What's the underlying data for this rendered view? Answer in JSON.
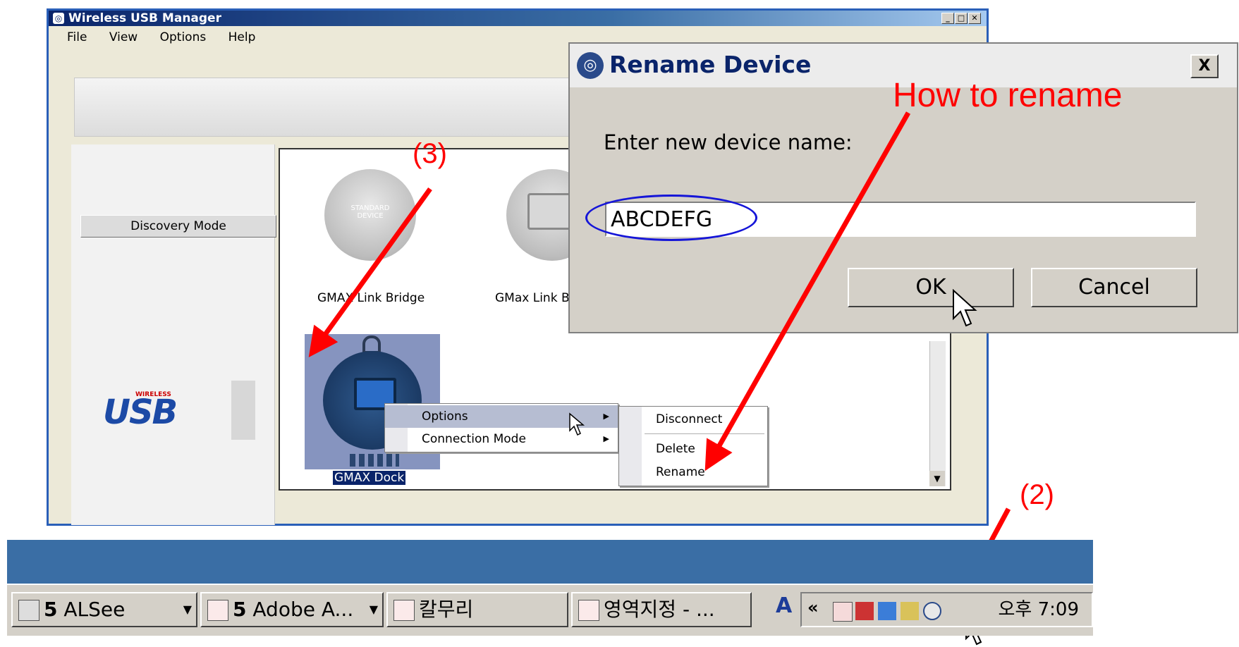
{
  "main_window": {
    "title": "Wireless USB Manager",
    "menu": [
      "File",
      "View",
      "Options",
      "Help"
    ],
    "discovery_button": "Discovery Mode",
    "logo_text": "USB",
    "logo_small": "WIRELESS",
    "devices": [
      {
        "name": "GMAX Link Bridge",
        "icon_text": "STANDARD DEVICE"
      },
      {
        "name": "GMax Link B"
      },
      {
        "name": "GMAX Dock",
        "selected": true
      }
    ]
  },
  "context_menu": {
    "items": [
      {
        "label": "Options",
        "submenu": true
      },
      {
        "label": "Connection Mode",
        "submenu": true
      }
    ]
  },
  "submenu": {
    "items": [
      "Disconnect",
      "Delete",
      "Rename"
    ]
  },
  "dialog": {
    "title": "Rename Device",
    "close": "X",
    "prompt": "Enter new device name:",
    "input_value": "ABCDEFG",
    "ok": "OK",
    "cancel": "Cancel"
  },
  "annotations": {
    "how_to_rename": "How to rename",
    "step3": "(3)",
    "step2": "(2)"
  },
  "taskbar": {
    "buttons": [
      {
        "count": "5",
        "label": "ALSee"
      },
      {
        "count": "5",
        "label": "Adobe A..."
      },
      {
        "label": "칼무리"
      },
      {
        "label": "영역지정 - ..."
      }
    ],
    "tray_text": "A",
    "tray_chevron": "«",
    "clock": "오후 7:09"
  },
  "colors": {
    "title_bar": "#0a246a",
    "annotation": "#ff0000",
    "ellipse": "#1515d8",
    "taskbar_band": "#3a6ea5"
  }
}
